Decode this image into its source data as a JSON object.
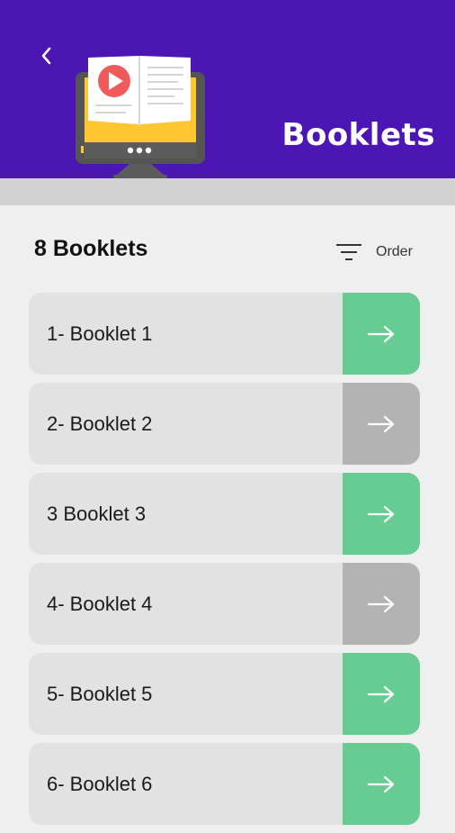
{
  "header": {
    "title": "Booklets",
    "back_icon": "chevron-left-icon",
    "background": "#4b16b3"
  },
  "summary": {
    "count_text": "8 Booklets"
  },
  "sort": {
    "label": "Order",
    "icon": "filter-lines-icon"
  },
  "colors": {
    "available": "#66cc92",
    "locked": "#b3b3b3",
    "card": "#e2e2e2"
  },
  "booklets": [
    {
      "label": "1- Booklet 1",
      "status": "available"
    },
    {
      "label": "2- Booklet 2",
      "status": "locked"
    },
    {
      "label": "3 Booklet 3",
      "status": "available"
    },
    {
      "label": "4- Booklet 4",
      "status": "locked"
    },
    {
      "label": "5- Booklet 5",
      "status": "available"
    },
    {
      "label": "6- Booklet 6",
      "status": "available"
    }
  ]
}
